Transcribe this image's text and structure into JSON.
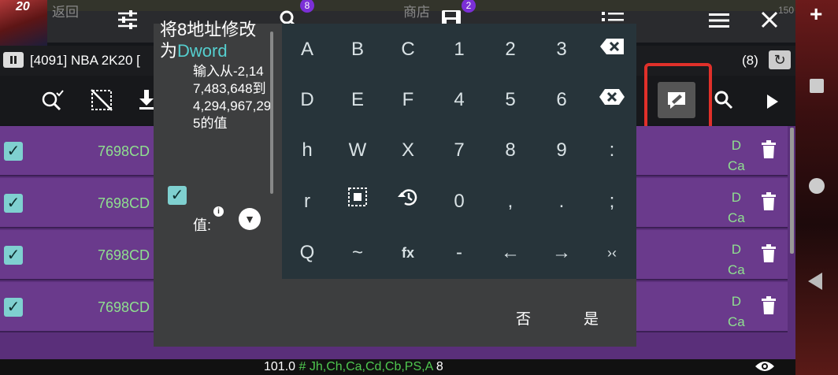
{
  "topbar": {
    "game_badge": "20",
    "back_label": "返回",
    "store_label": "商店",
    "right_count": "150",
    "search_badge": "8",
    "save_badge": "2"
  },
  "process": {
    "title": "[4091] NBA 2K20 [",
    "count": "(8)"
  },
  "results": [
    {
      "address": "7698CD",
      "type_top": "D",
      "type_bottom": "Ca"
    },
    {
      "address": "7698CD",
      "type_top": "D",
      "type_bottom": "Ca"
    },
    {
      "address": "7698CD",
      "type_top": "D",
      "type_bottom": "Ca"
    },
    {
      "address": "7698CD",
      "type_top": "D",
      "type_bottom": "Ca"
    }
  ],
  "status": {
    "value": "101.0",
    "hash": "#",
    "registers": "Jh,Ch,Ca,Cd,Cb,PS,A",
    "count": "8"
  },
  "dialog": {
    "title_prefix": "将8地址修改为",
    "title_type": "Dword",
    "description": "输入从-2,147,483,648到4,294,967,295的值",
    "value_label": "值:",
    "info_glyph": "i",
    "no_label": "否",
    "yes_label": "是"
  },
  "keyboard": {
    "rows": [
      [
        "A",
        "B",
        "C",
        "1",
        "2",
        "3",
        "⌫"
      ],
      [
        "D",
        "E",
        "F",
        "4",
        "5",
        "6",
        "⌦"
      ],
      [
        "h",
        "W",
        "X",
        "7",
        "8",
        "9",
        ":"
      ],
      [
        "r",
        "⬚",
        "↺",
        "0",
        ",",
        ".",
        ";"
      ],
      [
        "Q",
        "~",
        "fx",
        "-",
        "←",
        "→",
        "›‹"
      ]
    ]
  },
  "icons": {
    "filter": "filter-icon",
    "search": "search-icon",
    "save": "save-icon",
    "list": "list-icon",
    "menu": "menu-icon",
    "close": "close-icon",
    "edit": "edit-icon",
    "delete": "trash-icon",
    "eye": "eye-icon"
  },
  "colors": {
    "accent_teal": "#7fd0d0",
    "row_purple": "#6a3a8c",
    "address_green": "#8fe08f",
    "keyboard_bg": "#27343a",
    "highlight_red": "#e0302a"
  }
}
